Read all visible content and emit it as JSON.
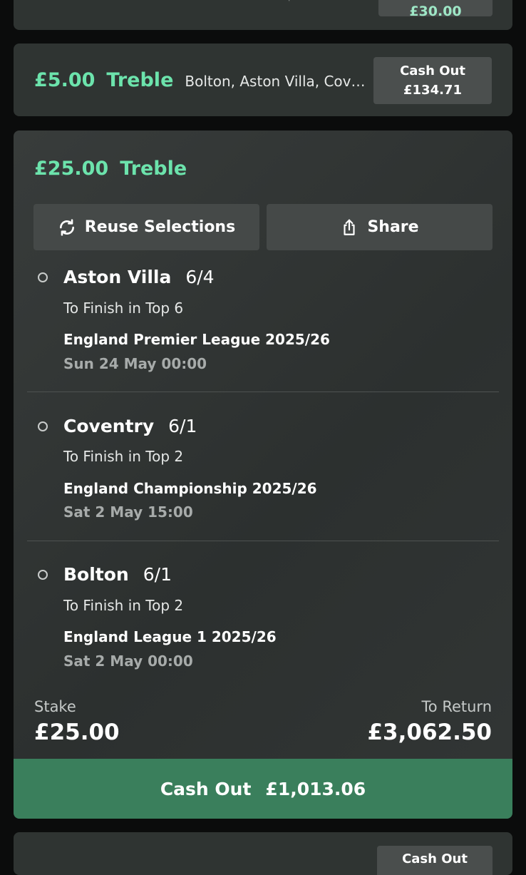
{
  "top_partial_card": {
    "cashout_value": "£30.00"
  },
  "collapsed_bet": {
    "stake": "£5.00",
    "type": "Treble",
    "teams": "Bolton, Aston Villa, Coventry",
    "cashout_label": "Cash Out",
    "cashout_value": "£134.71"
  },
  "main_bet": {
    "stake": "£25.00",
    "type": "Treble",
    "reuse_label": "Reuse Selections",
    "share_label": "Share",
    "selections": [
      {
        "team": "Aston Villa",
        "odds": "6/4",
        "market": "To Finish in Top 6",
        "league": "England Premier League 2025/26",
        "date": "Sun 24 May 00:00"
      },
      {
        "team": "Coventry",
        "odds": "6/1",
        "market": "To Finish in Top 2",
        "league": "England Championship 2025/26",
        "date": "Sat 2 May 15:00"
      },
      {
        "team": "Bolton",
        "odds": "6/1",
        "market": "To Finish in Top 2",
        "league": "England League 1 2025/26",
        "date": "Sat 2 May 00:00"
      }
    ],
    "stake_label": "Stake",
    "stake_value": "£25.00",
    "return_label": "To Return",
    "return_value": "£3,062.50",
    "cashout_label": "Cash Out",
    "cashout_value": "£1,013.06"
  },
  "bottom_partial_card": {
    "cashout_label": "Cash Out"
  },
  "colors": {
    "accent_green": "#6ce3ac",
    "cashout_green": "#3a7f5c",
    "card_bg": "#2f3432"
  }
}
